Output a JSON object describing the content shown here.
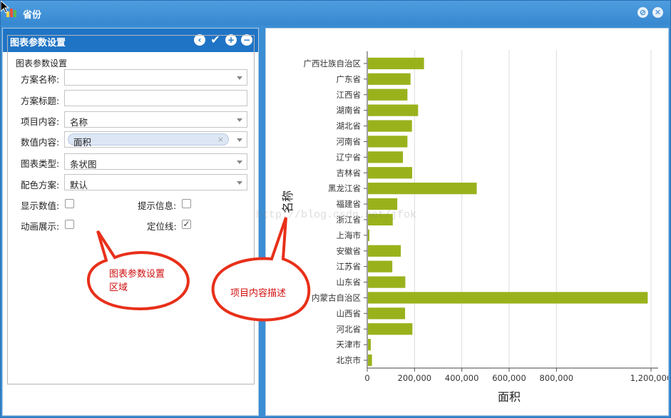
{
  "window": {
    "title": "省份"
  },
  "left_panel": {
    "header": "图表参数设置",
    "legend": "图表参数设置",
    "fields": {
      "scheme_name": {
        "label": "方案名称:",
        "value": ""
      },
      "scheme_title": {
        "label": "方案标题:",
        "value": ""
      },
      "item_content": {
        "label": "项目内容:",
        "value": "名称"
      },
      "value_content": {
        "label": "数值内容:",
        "value": "面积"
      },
      "chart_type": {
        "label": "图表类型:",
        "value": "条状图"
      },
      "color_scheme": {
        "label": "配色方案:",
        "value": "默认"
      }
    },
    "checkboxes": {
      "show_values": {
        "label": "显示数值:",
        "checked": false
      },
      "tooltip": {
        "label": "提示信息:",
        "checked": false
      },
      "animation": {
        "label": "动画展示:",
        "checked": false
      },
      "gridline": {
        "label": "定位线:",
        "checked": true
      }
    },
    "callout": "图表参数设置\n区域"
  },
  "chart_callout": "项目内容描述",
  "chart_data": {
    "type": "bar",
    "orientation": "horizontal",
    "categories": [
      "广西壮族自治区",
      "广东省",
      "江西省",
      "湖南省",
      "湖北省",
      "河南省",
      "辽宁省",
      "吉林省",
      "黑龙江省",
      "福建省",
      "浙江省",
      "上海市",
      "安徽省",
      "江苏省",
      "山东省",
      "内蒙古自治区",
      "山西省",
      "河北省",
      "天津市",
      "北京市"
    ],
    "values": [
      237000,
      180000,
      167000,
      212000,
      186000,
      167000,
      148000,
      187000,
      460000,
      124000,
      105000,
      6000,
      139000,
      103000,
      158000,
      1183000,
      157000,
      188000,
      12000,
      17000
    ],
    "xlabel": "面积",
    "ylabel": "名称",
    "xticks": [
      "0",
      "200,000",
      "400,000",
      "600,000",
      "800,000",
      "1,200,000"
    ],
    "xlim": [
      0,
      1200000
    ],
    "bar_color": "#99b21c",
    "grid": true
  },
  "watermark": "http://blog.csdn.net/jfok"
}
